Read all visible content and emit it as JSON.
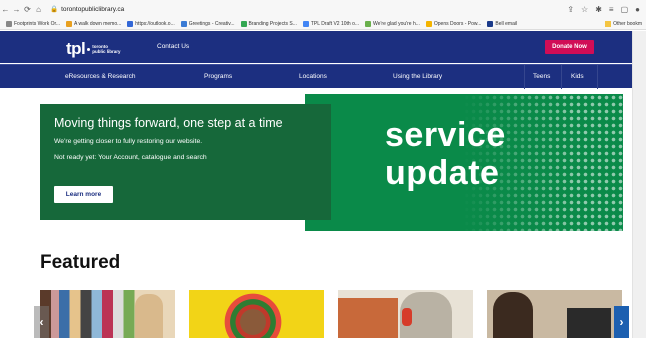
{
  "browser": {
    "url": "torontopubliclibrary.ca",
    "bookmarks": [
      {
        "label": "Footprints Work Or...",
        "color": "#888888"
      },
      {
        "label": "A walk down memo...",
        "color": "#e8a020"
      },
      {
        "label": "https://outlook.o...",
        "color": "#3367d6"
      },
      {
        "label": "Greetings - Creativ...",
        "color": "#3a7bd5"
      },
      {
        "label": "Branding Projects S...",
        "color": "#34a853"
      },
      {
        "label": "TPL Draft V2 10th o...",
        "color": "#4285f4"
      },
      {
        "label": "We're glad you're h...",
        "color": "#6ab04c"
      },
      {
        "label": "Opens Doors - Pow...",
        "color": "#f4b400"
      },
      {
        "label": "Bell email",
        "color": "#1a3a8a"
      }
    ],
    "other_bookmarks": "Other bookm"
  },
  "header": {
    "logo_main": "tpl",
    "logo_sub_1": "toronto",
    "logo_sub_2": "public library",
    "contact_label": "Contact Us",
    "donate_label": "Donate Now"
  },
  "nav": {
    "items": [
      "eResources & Research",
      "Programs",
      "Locations",
      "Using the Library",
      "Teens",
      "Kids"
    ]
  },
  "hero": {
    "heading": "Moving things forward, one step at a time",
    "line1": "We're getting closer to fully restoring our website.",
    "line2": "Not ready yet: Your Account, catalogue and search",
    "button": "Learn more",
    "banner_line1": "service",
    "banner_line2": "update"
  },
  "featured": {
    "title": "Featured"
  },
  "colors": {
    "brand_blue": "#1c2f80",
    "donate_pink": "#d10d56",
    "hero_green": "#0a8a49",
    "card_green": "#16683a"
  }
}
